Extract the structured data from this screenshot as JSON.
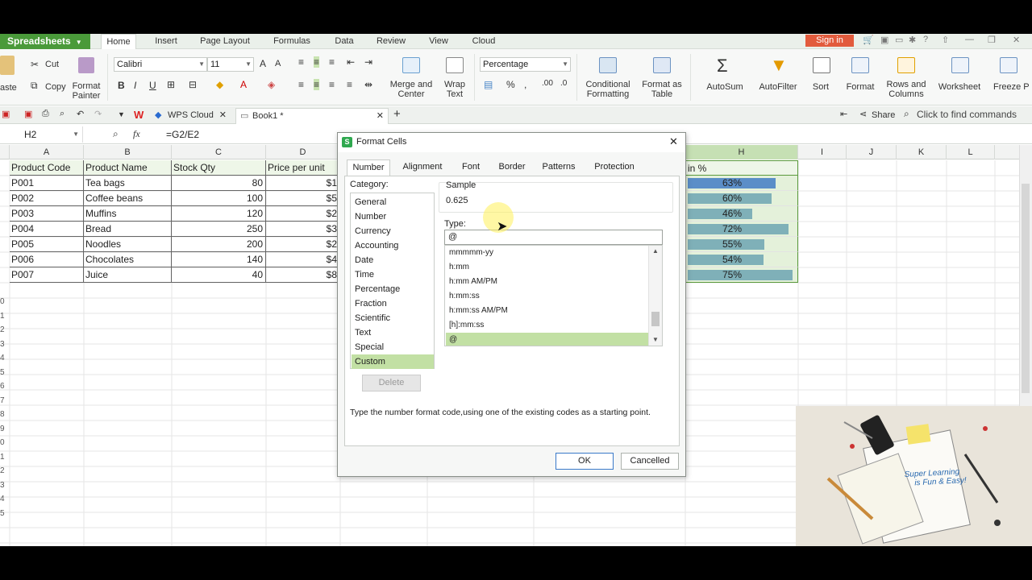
{
  "app": {
    "name": "Spreadsheets",
    "menu": [
      "Home",
      "Insert",
      "Page Layout",
      "Formulas",
      "Data",
      "Review",
      "View",
      "Cloud"
    ],
    "signin": "Sign in"
  },
  "ribbon": {
    "cut": "Cut",
    "paste": "aste",
    "copy": "Copy",
    "format_painter": [
      "Format",
      "Painter"
    ],
    "font": "Calibri",
    "size": "11",
    "merge": [
      "Merge and",
      "Center"
    ],
    "wrap": [
      "Wrap",
      "Text"
    ],
    "number_format": "Percentage",
    "conditional": [
      "Conditional",
      "Formatting"
    ],
    "format_table": [
      "Format as",
      "Table"
    ],
    "autosum": "AutoSum",
    "autofilter": "AutoFilter",
    "sort": "Sort",
    "format": "Format",
    "rows_cols": [
      "Rows and",
      "Columns"
    ],
    "worksheet": "Worksheet",
    "freeze": "Freeze P"
  },
  "tabbar": {
    "cloud_tab": "WPS Cloud",
    "book_tab": "Book1 *",
    "share": "Share",
    "find": "Click to find commands"
  },
  "formula_bar": {
    "name_box": "H2",
    "fx": "fx",
    "formula": "=G2/E2"
  },
  "columns": [
    "A",
    "B",
    "C",
    "D",
    "H",
    "I",
    "J",
    "K",
    "L"
  ],
  "headers": {
    "a": "Product Code",
    "b": "Product Name",
    "c": "Stock Qty",
    "d": "Price per unit",
    "h": "in %"
  },
  "rows": [
    {
      "code": "P001",
      "name": "Tea bags",
      "qty": "80",
      "price": "$1",
      "pct": "63%",
      "pct_value": 0.63
    },
    {
      "code": "P002",
      "name": "Coffee beans",
      "qty": "100",
      "price": "$5",
      "pct": "60%",
      "pct_value": 0.6
    },
    {
      "code": "P003",
      "name": "Muffins",
      "qty": "120",
      "price": "$2",
      "pct": "46%",
      "pct_value": 0.46
    },
    {
      "code": "P004",
      "name": "Bread",
      "qty": "250",
      "price": "$3",
      "pct": "72%",
      "pct_value": 0.72
    },
    {
      "code": "P005",
      "name": "Noodles",
      "qty": "200",
      "price": "$2",
      "pct": "55%",
      "pct_value": 0.55
    },
    {
      "code": "P006",
      "name": "Chocolates",
      "qty": "140",
      "price": "$4",
      "pct": "54%",
      "pct_value": 0.54
    },
    {
      "code": "P007",
      "name": "Juice",
      "qty": "40",
      "price": "$8",
      "pct": "75%",
      "pct_value": 0.75
    }
  ],
  "row_numbers": [
    "0",
    "1",
    "2",
    "3",
    "4",
    "5",
    "6",
    "7",
    "8",
    "9",
    "0",
    "1",
    "2",
    "3",
    "4",
    "5"
  ],
  "dialog": {
    "title": "Format Cells",
    "tabs": [
      "Number",
      "Alignment",
      "Font",
      "Border",
      "Patterns",
      "Protection"
    ],
    "category_label": "Category:",
    "categories": [
      "General",
      "Number",
      "Currency",
      "Accounting",
      "Date",
      "Time",
      "Percentage",
      "Fraction",
      "Scientific",
      "Text",
      "Special",
      "Custom"
    ],
    "sample_label": "Sample",
    "sample_value": "0.625",
    "type_label": "Type:",
    "type_value": "@",
    "types": [
      "mmmmm-yy",
      "h:mm",
      "h:mm AM/PM",
      "h:mm:ss",
      "h:mm:ss AM/PM",
      "[h]:mm:ss",
      "@"
    ],
    "delete": "Delete",
    "hint": "Type the number format code,using one of the existing codes as a starting point.",
    "ok": "OK",
    "cancel": "Cancelled"
  },
  "promo": {
    "line1": "Super Learning",
    "line2": "is Fun & Easy!"
  },
  "colors": {
    "accent": "#4a9a3a",
    "selection": "#c2e0a4",
    "bar": "#7fb0b8",
    "bar_first": "#5b8ec8"
  }
}
